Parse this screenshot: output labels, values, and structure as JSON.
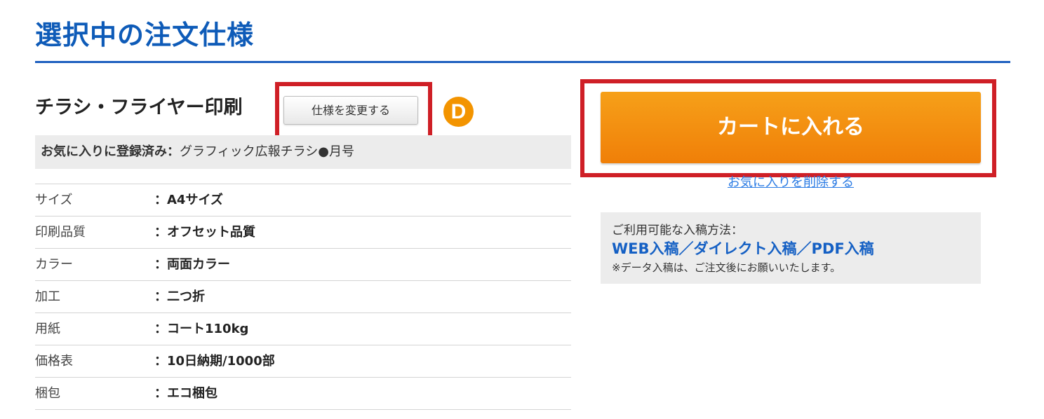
{
  "page": {
    "title": "選択中の注文仕様"
  },
  "product": {
    "name": "チラシ・フライヤー印刷",
    "change_spec_label": "仕様を変更する",
    "marker_letter": "D"
  },
  "favorite": {
    "label": "お気に入りに登録済み：",
    "name": "グラフィック広報チラシ●月号"
  },
  "specs": [
    {
      "label": "サイズ",
      "value": "：A4サイズ"
    },
    {
      "label": "印刷品質",
      "value": "：オフセット品質"
    },
    {
      "label": "カラー",
      "value": "：両面カラー"
    },
    {
      "label": "加工",
      "value": "：二つ折"
    },
    {
      "label": "用紙",
      "value": "：コート110kg"
    },
    {
      "label": "価格表",
      "value": "：10日納期/1000部"
    },
    {
      "label": "梱包",
      "value": "：エコ梱包"
    }
  ],
  "cart": {
    "add_label": "カートに入れる",
    "remove_favorite_label": "お気に入りを削除する"
  },
  "submission": {
    "caption": "ご利用可能な入稿方法：",
    "methods": "WEB入稿／ダイレクト入稿／PDF入稿",
    "note": "※データ入稿は、ご注文後にお願いいたします。"
  },
  "colors": {
    "title_blue": "#0e5bb8",
    "cart_orange": "#f39400",
    "highlight_red": "#cf1f26",
    "link_blue": "#2a7be4"
  }
}
